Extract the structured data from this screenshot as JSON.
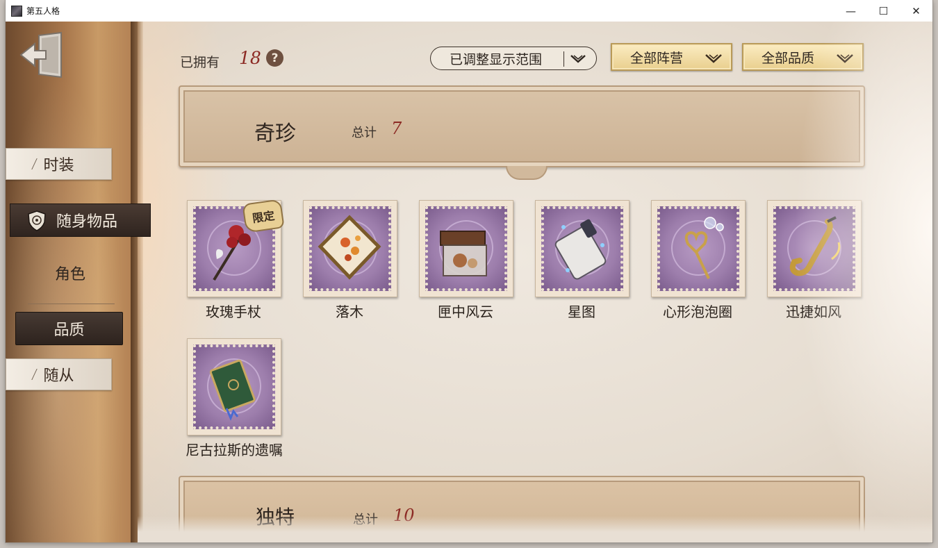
{
  "window": {
    "title": "第五人格",
    "controls": [
      "—",
      "☐",
      "✕"
    ]
  },
  "sidebar": {
    "tabs": [
      {
        "label": "时装"
      },
      {
        "label": "随身物品"
      },
      {
        "label": "角色"
      },
      {
        "label": "品质"
      },
      {
        "label": "随从"
      }
    ]
  },
  "toolbar": {
    "owned_label": "已拥有",
    "owned_count": "18",
    "help": "?",
    "range_filter": "已调整显示范围",
    "camp_filter": "全部阵营",
    "quality_filter": "全部品质"
  },
  "category": {
    "title": "奇珍",
    "total_label": "总计",
    "total": "7"
  },
  "items": [
    {
      "name": "玫瑰手杖",
      "badge": "限定",
      "icon": "rose-cane-icon"
    },
    {
      "name": "落木",
      "icon": "falling-leaves-frame-icon"
    },
    {
      "name": "匣中风云",
      "icon": "treasure-box-icon"
    },
    {
      "name": "星图",
      "icon": "star-chart-scroll-icon"
    },
    {
      "name": "心形泡泡圈",
      "icon": "heart-bubble-wand-icon"
    },
    {
      "name": "迅捷如风",
      "icon": "saxophone-icon"
    },
    {
      "name": "尼古拉斯的遗嘱",
      "icon": "green-book-icon"
    }
  ],
  "next_category": {
    "title": "独特",
    "total_label": "总计",
    "total": "10"
  },
  "colors": {
    "accent_red": "#8c2a24",
    "stamp_purple": "#9d7eac",
    "gold": "#e9cf8e",
    "dark_tab": "#2f241f"
  }
}
